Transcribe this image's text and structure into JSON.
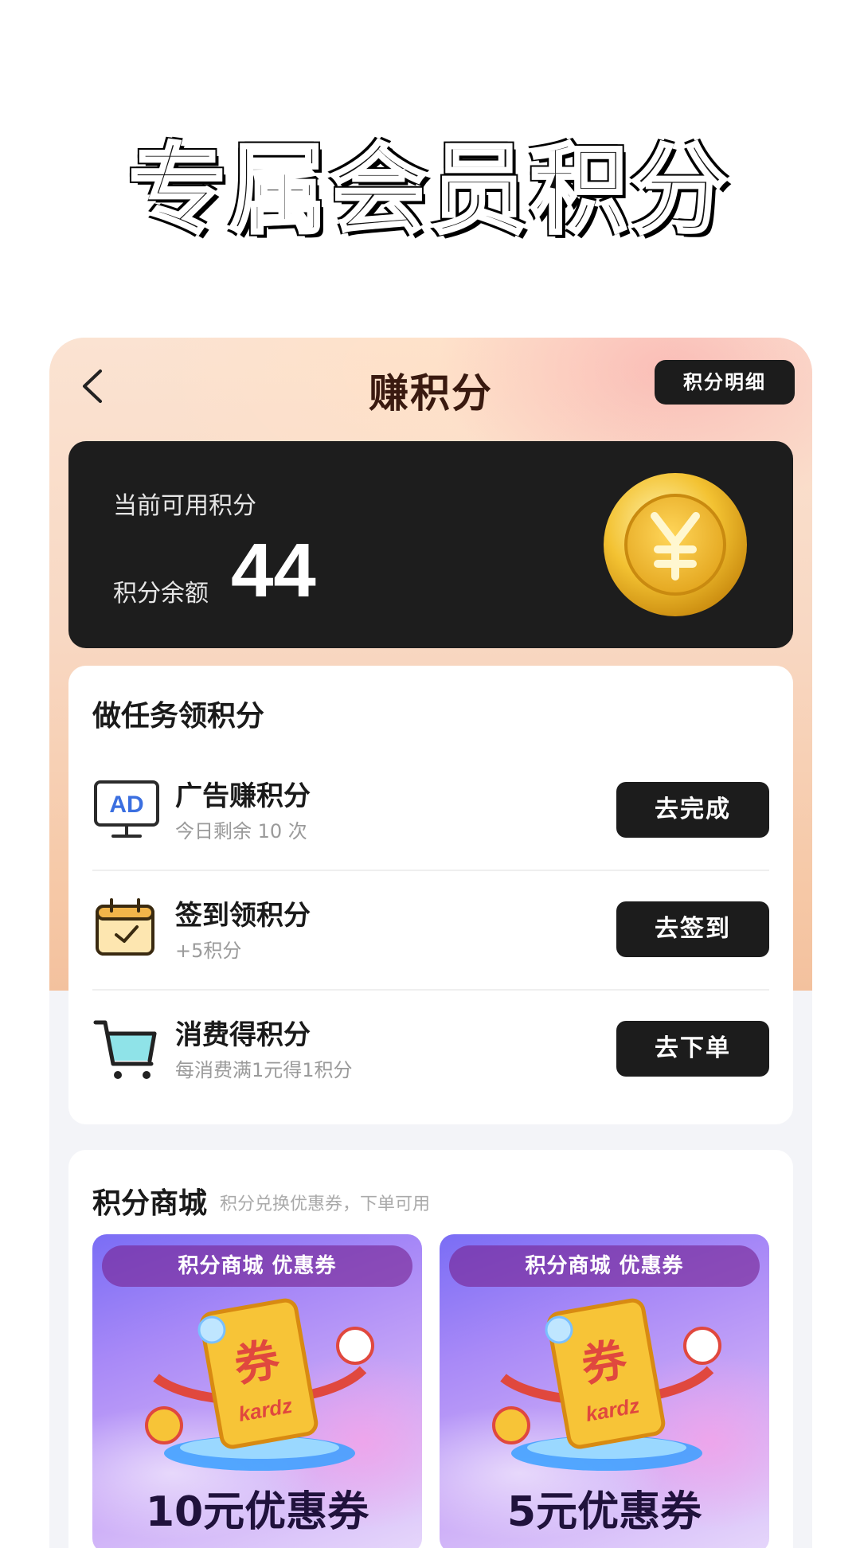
{
  "hero": {
    "title": "专属会员积分"
  },
  "header": {
    "title": "赚积分",
    "detail_button": "积分明细"
  },
  "points": {
    "available_label": "当前可用积分",
    "balance_label": "积分余额",
    "balance_value": "44"
  },
  "tasks": {
    "title": "做任务领积分",
    "items": [
      {
        "name": "广告赚积分",
        "sub": "今日剩余 10 次",
        "button": "去完成",
        "icon": "ad-monitor-icon"
      },
      {
        "name": "签到领积分",
        "sub": "+5积分",
        "button": "去签到",
        "icon": "calendar-check-icon"
      },
      {
        "name": "消费得积分",
        "sub": "每消费满1元得1积分",
        "button": "去下单",
        "icon": "shopping-cart-icon"
      }
    ]
  },
  "mall": {
    "title": "积分商城",
    "subtitle": "积分兑换优惠券，下单可用",
    "coupons": [
      {
        "tag": "积分商城 优惠券",
        "amount": "10元优惠券",
        "art_text": "券",
        "brand": "kardz"
      },
      {
        "tag": "积分商城 优惠券",
        "amount": "5元优惠券",
        "art_text": "券",
        "brand": "kardz"
      }
    ]
  },
  "colors": {
    "dark": "#1c1c1c",
    "gold": "#f2c23a",
    "accent_blue": "#3b6fe0"
  }
}
